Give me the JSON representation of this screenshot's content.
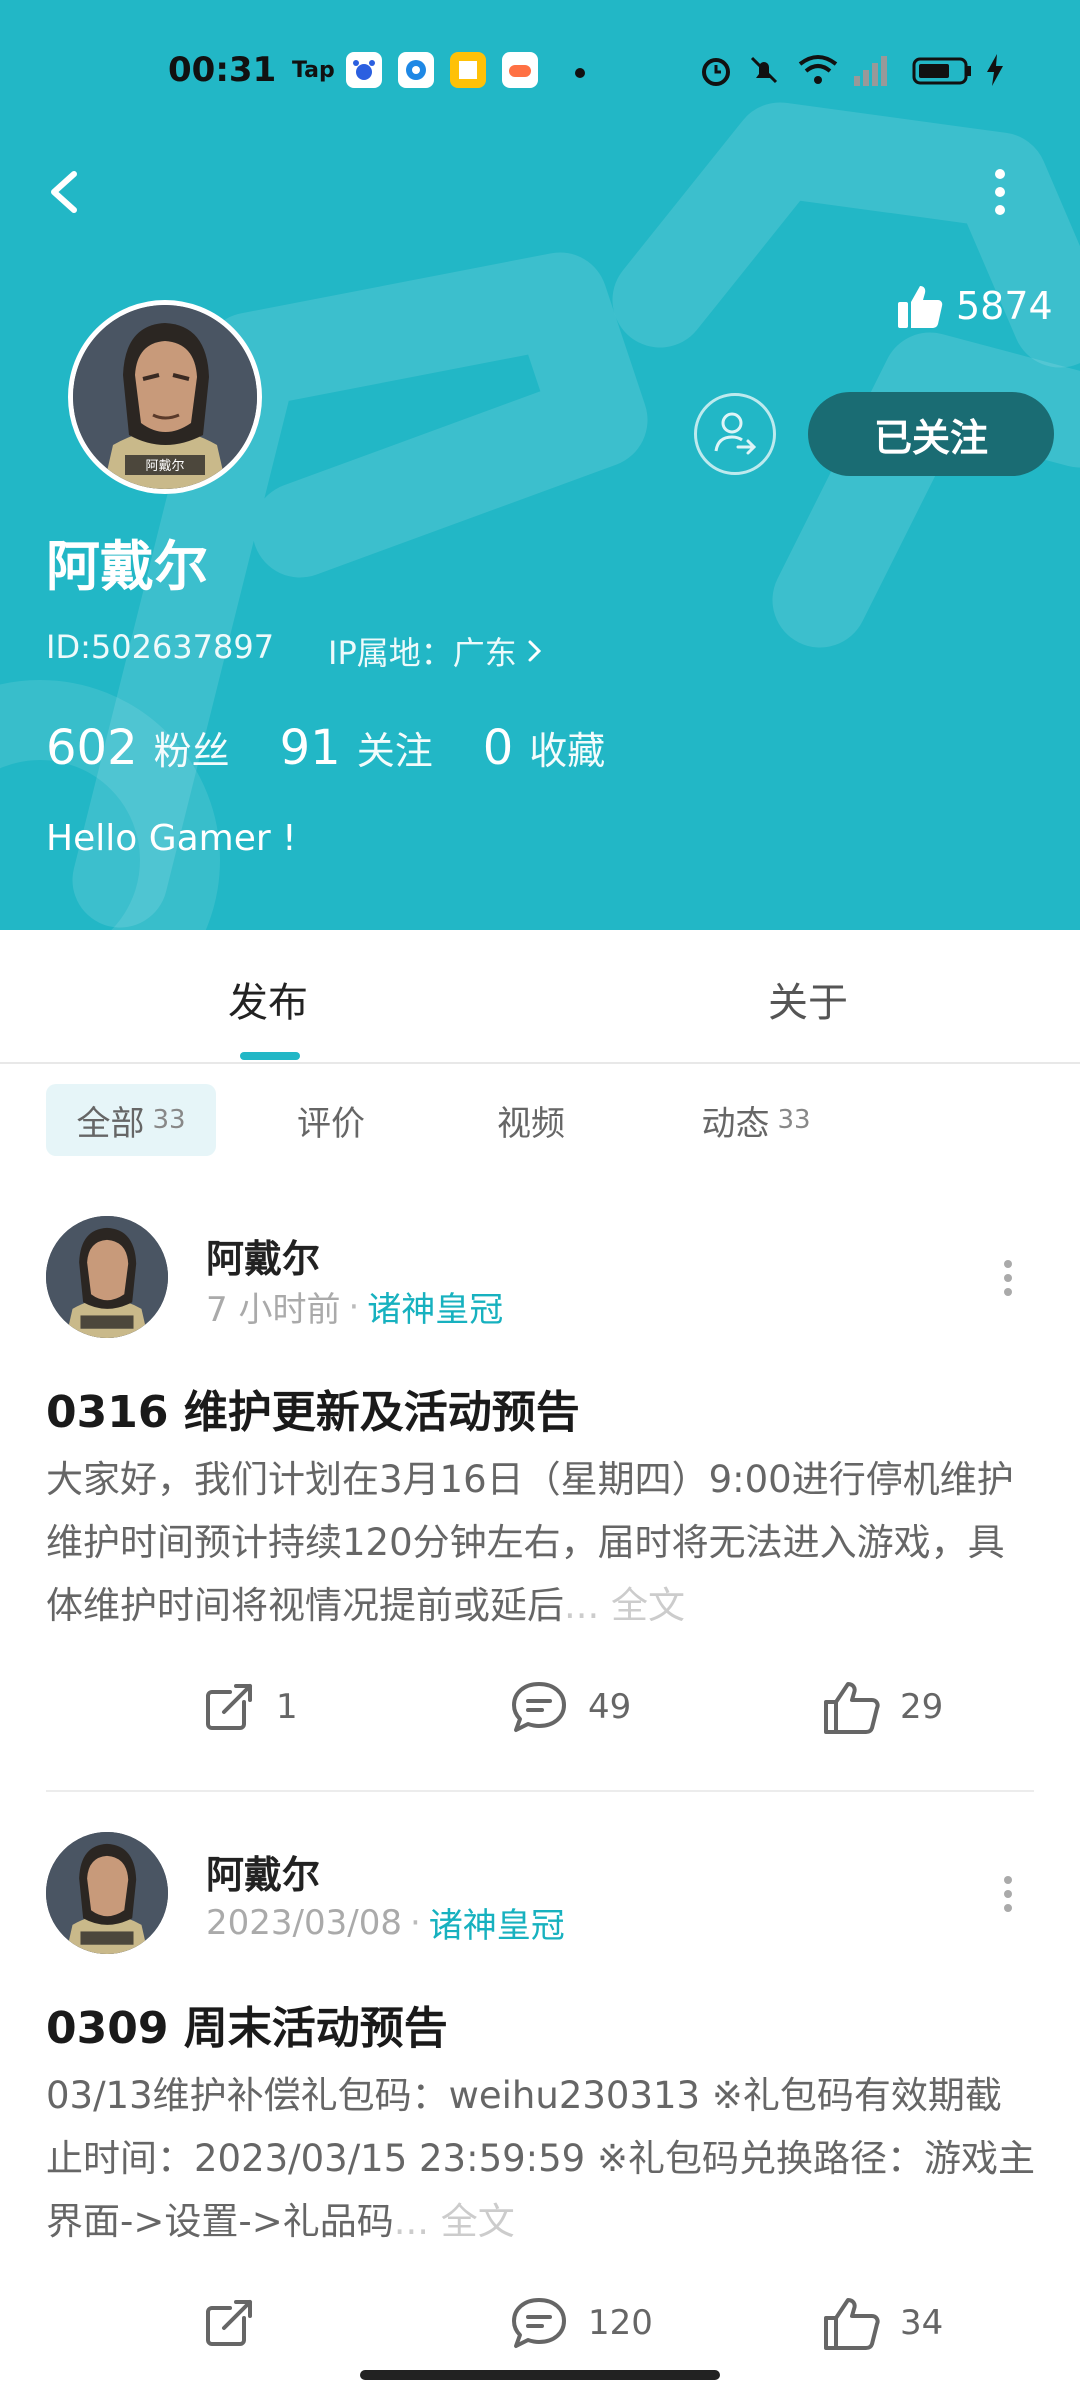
{
  "status_bar": {
    "time": "00:31",
    "tap_label": "Tap",
    "icons": [
      "taptap-icon",
      "baidu-icon",
      "browser-icon",
      "reader-icon",
      "game-icon",
      "dot-icon",
      "alarm-icon",
      "mute-icon",
      "wifi-icon",
      "signal-icon",
      "battery-icon",
      "charging-icon"
    ]
  },
  "colors": {
    "accent": "#22b7c6",
    "follow_button": "#1a6c73",
    "game_link": "#17b1bf"
  },
  "profile": {
    "like_count": "5874",
    "follow_button": "已关注",
    "avatar_caption": "阿戴尔",
    "name": "阿戴尔",
    "id": "ID:502637897",
    "ip_location": "IP属地：广东",
    "stats": [
      {
        "num": "602",
        "label": "粉丝"
      },
      {
        "num": "91",
        "label": "关注"
      },
      {
        "num": "0",
        "label": "收藏"
      }
    ],
    "bio": "Hello Gamer !"
  },
  "tabs": {
    "publish": "发布",
    "about": "关于"
  },
  "filters": [
    {
      "label": "全部",
      "count": "33"
    },
    {
      "label": "评价",
      "count": ""
    },
    {
      "label": "视频",
      "count": ""
    },
    {
      "label": "动态",
      "count": "33"
    }
  ],
  "posts": [
    {
      "author": "阿戴尔",
      "time": "7 小时前",
      "game": "诸神皇冠",
      "title": "0316 维护更新及活动预告",
      "body": "大家好，我们计划在3月16日（星期四）9:00进行停机维护维护时间预计持续120分钟左右，届时将无法进入游戏，具体维护时间将视情况提前或延后",
      "more": "... 全文",
      "shares": "1",
      "comments": "49",
      "likes": "29"
    },
    {
      "author": "阿戴尔",
      "time": "2023/03/08",
      "game": "诸神皇冠",
      "title": "0309 周末活动预告",
      "body": "03/13维护补偿礼包码：weihu230313 ※礼包码有效期截止时间：2023/03/15 23:59:59 ※礼包码兑换路径：游戏主界面->设置->礼品码",
      "more": "... 全文",
      "shares": "",
      "comments": "120",
      "likes": "34"
    }
  ]
}
